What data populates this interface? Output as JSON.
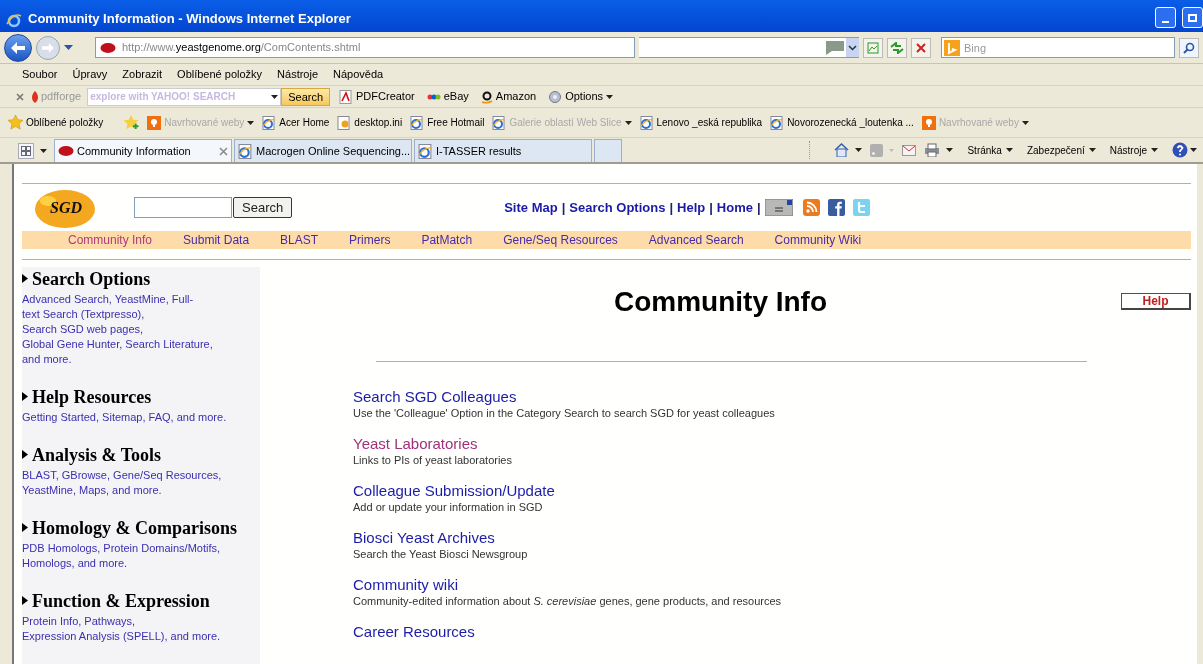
{
  "window": {
    "title": "Community Information - Windows Internet Explorer"
  },
  "address": {
    "url_prefix": "http://www.",
    "url_domain": "yeastgenome.org",
    "url_path": "/ComContents.shtml",
    "search_placeholder": "Bing"
  },
  "menu": [
    "Soubor",
    "Úpravy",
    "Zobrazit",
    "Oblíbené položky",
    "Nástroje",
    "Nápověda"
  ],
  "toolbar": {
    "brand": "pdfforge",
    "search_placeholder": "explore with YAHOO! SEARCH",
    "search_button": "Search",
    "items": [
      {
        "label": "PDFCreator",
        "kind": "pdf"
      },
      {
        "label": "eBay",
        "kind": "ebay"
      },
      {
        "label": "Amazon",
        "kind": "amazon"
      },
      {
        "label": "Options",
        "kind": "gear"
      }
    ]
  },
  "favorites": {
    "label": "Oblíbené položky",
    "items": [
      {
        "label": "Navrhované weby",
        "kind": "suggested",
        "disabled": true
      },
      {
        "label": "Acer Home",
        "kind": "page",
        "disabled": false
      },
      {
        "label": "desktop.ini",
        "kind": "file",
        "disabled": false
      },
      {
        "label": "Free Hotmail",
        "kind": "page",
        "disabled": false
      },
      {
        "label": "Galerie oblastí Web Slice",
        "kind": "page",
        "disabled": true
      },
      {
        "label": "Lenovo _eská republika",
        "kind": "page",
        "disabled": false
      },
      {
        "label": "Novorozenecká _loutenka ...",
        "kind": "page",
        "disabled": false
      },
      {
        "label": "Navrhované weby",
        "kind": "suggested",
        "disabled": true
      }
    ]
  },
  "tabs": [
    {
      "label": "Community Information",
      "selected": true
    },
    {
      "label": "Macrogen Online Sequencing...",
      "selected": false
    },
    {
      "label": "I-TASSER results",
      "selected": false
    }
  ],
  "commands": [
    "Stránka",
    "Zabezpečení",
    "Nástroje"
  ],
  "site": {
    "logo": "SGD",
    "search_button": "Search",
    "top_links": [
      {
        "kind": "link",
        "label": "Site Map"
      },
      {
        "kind": "sep",
        "label": "|"
      },
      {
        "kind": "link",
        "label": "Search Options"
      },
      {
        "kind": "sep",
        "label": "|"
      },
      {
        "kind": "link",
        "label": "Help"
      },
      {
        "kind": "sep",
        "label": "|"
      },
      {
        "kind": "link",
        "label": "Home"
      },
      {
        "kind": "sep",
        "label": "|"
      }
    ],
    "nav": [
      {
        "label": "Community Info",
        "visited": true
      },
      {
        "label": "Submit Data",
        "visited": false
      },
      {
        "label": "BLAST",
        "visited": false
      },
      {
        "label": "Primers",
        "visited": false
      },
      {
        "label": "PatMatch",
        "visited": false
      },
      {
        "label": "Gene/Seq Resources",
        "visited": false
      },
      {
        "label": "Advanced Search",
        "visited": false
      },
      {
        "label": "Community Wiki",
        "visited": false
      }
    ]
  },
  "sidebar": [
    {
      "title": "Search Options",
      "lines": [
        "Advanced Search, YeastMine, Full-",
        "text Search (Textpresso),",
        "Search SGD web pages,",
        "Global Gene Hunter, Search Literature,",
        "and more."
      ]
    },
    {
      "title": "Help Resources",
      "lines": [
        "Getting Started, Sitemap, FAQ, and more."
      ]
    },
    {
      "title": "Analysis & Tools",
      "lines": [
        "BLAST, GBrowse, Gene/Seq Resources,",
        "YeastMine, Maps, and more."
      ]
    },
    {
      "title": "Homology & Comparisons",
      "lines": [
        "PDB Homologs, Protein Domains/Motifs,",
        "Homologs, and more."
      ]
    },
    {
      "title": "Function & Expression",
      "lines": [
        "Protein Info, Pathways,",
        "Expression Analysis (SPELL), and more."
      ]
    }
  ],
  "main": {
    "title": "Community Info",
    "help_button": "Help",
    "links": [
      {
        "title": "Search SGD Colleagues",
        "description": "Use the 'Colleague' Option in the Category Search to search SGD for yeast colleagues",
        "visited": false
      },
      {
        "title": "Yeast Laboratories",
        "description": "Links to PIs of yeast laboratories",
        "visited": true
      },
      {
        "title": "Colleague Submission/Update",
        "description": "Add or update your information in SGD",
        "visited": false
      },
      {
        "title": "Biosci Yeast Archives",
        "description": "Search the Yeast Biosci Newsgroup",
        "visited": false
      },
      {
        "title": "Community wiki",
        "description": "Community-edited information about *S. cerevisiae* genes, gene products, and resources",
        "visited": false
      },
      {
        "title": "Career Resources",
        "visited": false
      }
    ]
  }
}
